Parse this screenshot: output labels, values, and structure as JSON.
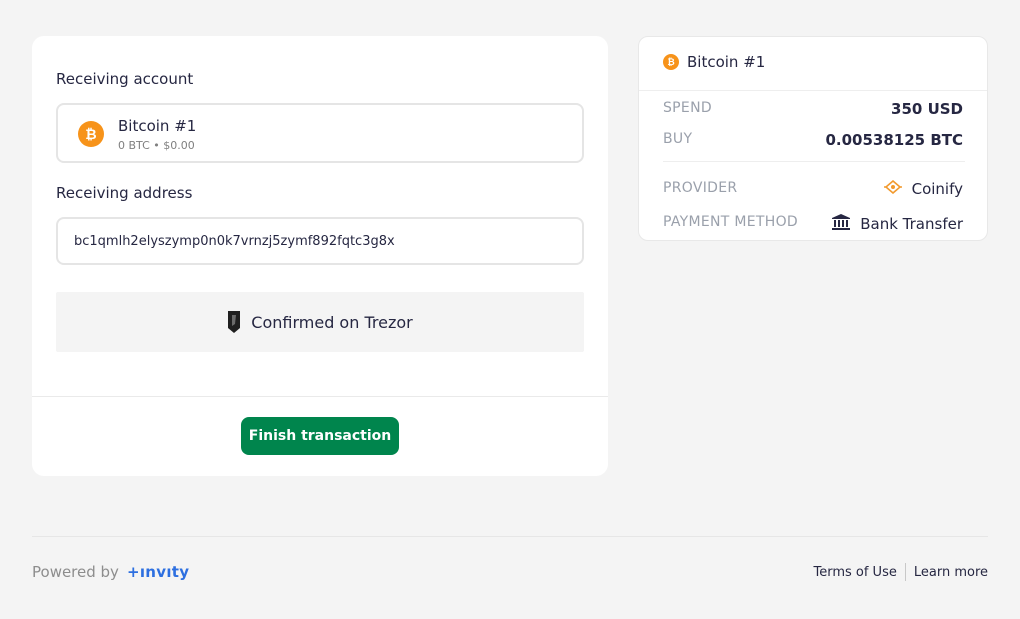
{
  "receive": {
    "account_label": "Receiving account",
    "account_name": "Bitcoin #1",
    "account_balance": "0 BTC • $0.00",
    "address_label": "Receiving address",
    "address_value": "bc1qmlh2elyszymp0n0k7vrnzj5zymf892fqtc3g8x",
    "confirmed_text": "Confirmed on Trezor",
    "finish_button": "Finish transaction"
  },
  "summary": {
    "title": "Bitcoin #1",
    "spend_label": "SPEND",
    "spend_value": "350 USD",
    "buy_label": "BUY",
    "buy_value": "0.00538125 BTC",
    "provider_label": "PROVIDER",
    "provider_value": "Coinify",
    "payment_label": "PAYMENT METHOD",
    "payment_value": "Bank Transfer"
  },
  "footer": {
    "powered_by": "Powered by",
    "brand": "+ınvıty",
    "terms": "Terms of Use",
    "learn_more": "Learn more"
  },
  "icons": {
    "coin": "bitcoin-icon",
    "device": "trezor-icon",
    "provider": "coinify-icon",
    "payment": "bank-icon"
  },
  "colors": {
    "accent_green": "#00854d",
    "bitcoin_orange": "#f7931a",
    "invity_blue": "#2d6fe0"
  }
}
